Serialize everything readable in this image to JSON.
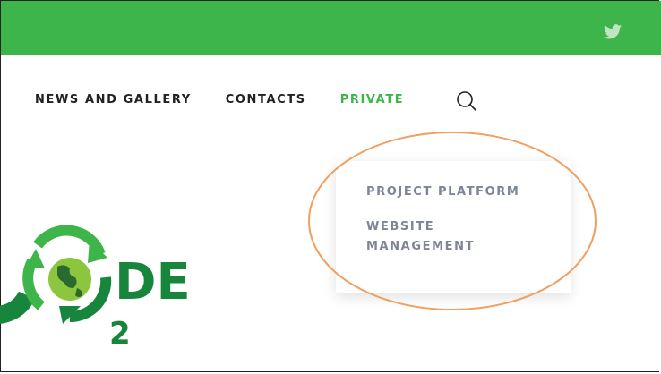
{
  "header": {
    "twitter_icon": "twitter-icon"
  },
  "nav": {
    "items": [
      {
        "label": "NEWS AND GALLERY"
      },
      {
        "label": "CONTACTS"
      },
      {
        "label": "PRIVATE",
        "active": true
      }
    ],
    "search_icon": "search-icon"
  },
  "dropdown": {
    "items": [
      {
        "label": "PROJECT PLATFORM"
      },
      {
        "label": "WEBSITE MANAGEMENT"
      }
    ]
  },
  "logo": {
    "text": "DE",
    "subscript": "2"
  },
  "colors": {
    "brand_green": "#3db54a",
    "dark_green": "#17853b",
    "highlight_orange": "#f0a060",
    "dropdown_text": "#7d8596"
  }
}
